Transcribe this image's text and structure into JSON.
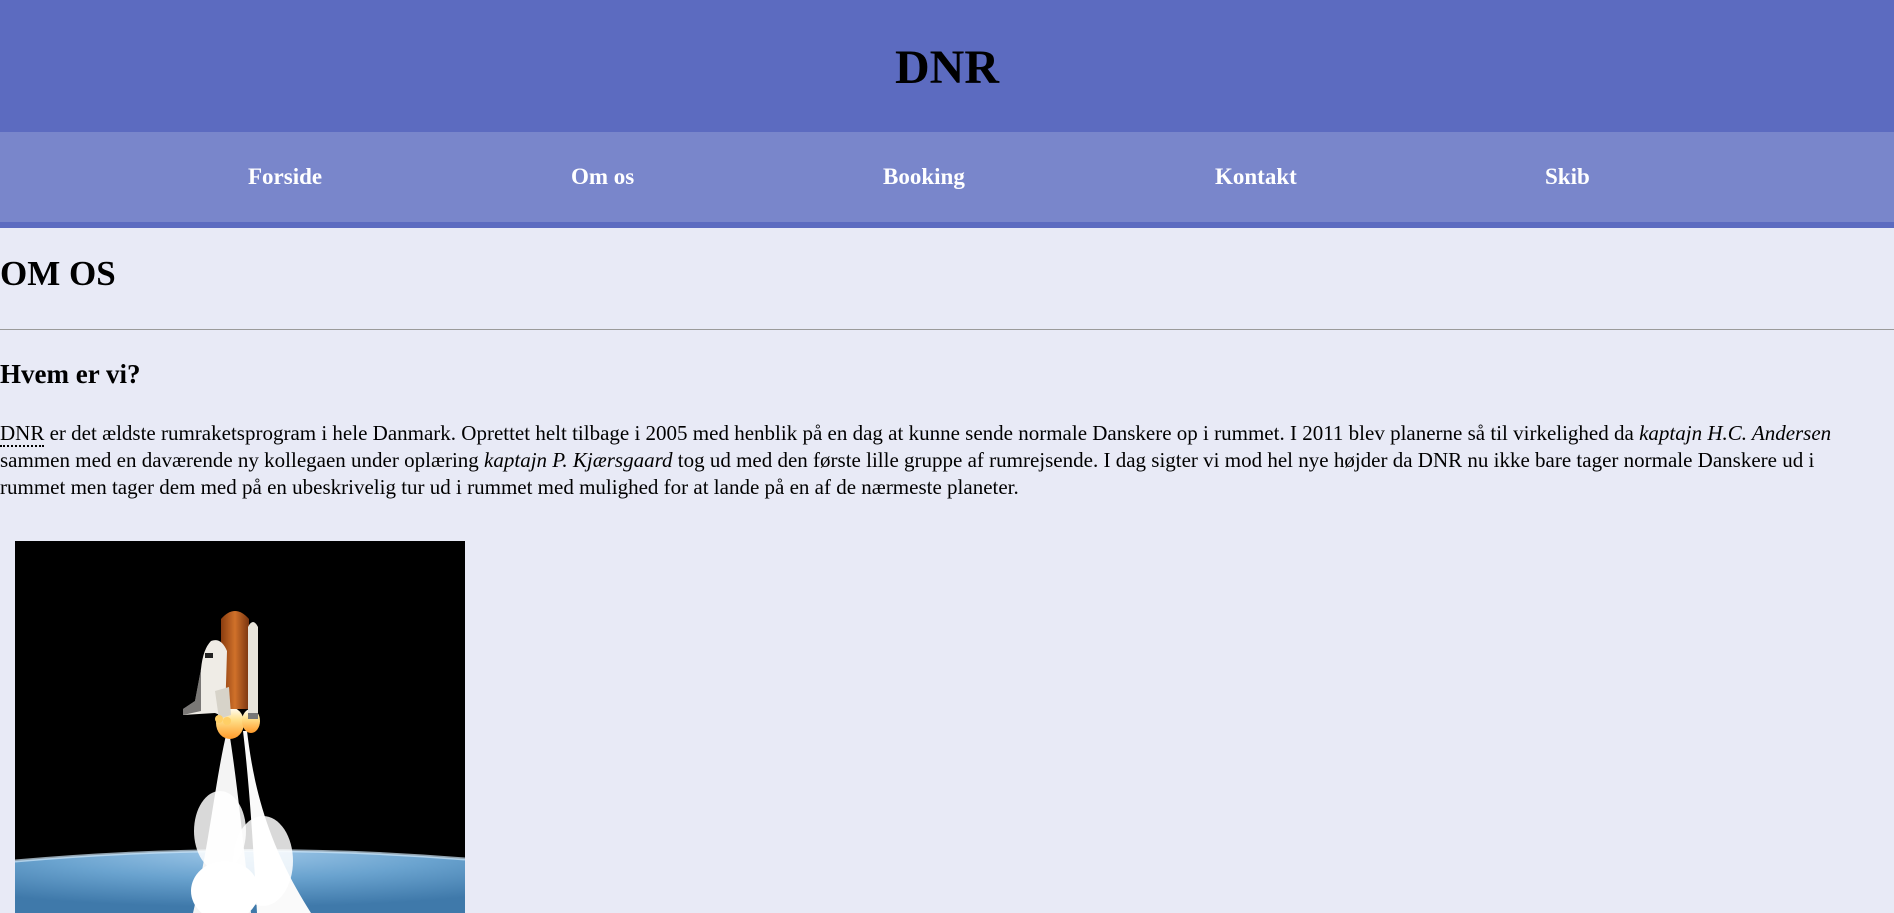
{
  "site": {
    "title": "DNR"
  },
  "nav": {
    "items": [
      {
        "label": "Forside"
      },
      {
        "label": "Om os"
      },
      {
        "label": "Booking"
      },
      {
        "label": "Kontakt"
      },
      {
        "label": "Skib"
      }
    ]
  },
  "main": {
    "page_title": "OM OS",
    "section_title": "Hvem er vi?",
    "intro": {
      "abbr": "DNR",
      "text_1": " er det ældste rumraketsprogram i hele Danmark. Oprettet helt tilbage i 2005 med henblik på en dag at kunne sende normale Danskere op i rummet. I 2011 blev planerne så til virkelighed da ",
      "captain_1": "kaptajn H.C. Andersen",
      "text_2": " sammen med en daværende ny kollegaen under oplæring ",
      "captain_2": "kaptajn P. Kjærsgaard",
      "text_3": " tog ud med den første lille gruppe af rumrejsende. I dag sigter vi mod hel nye højder da DNR nu ikke bare tager normale Danskere ud i rummet men tager dem med på en ubeskrivelig tur ud i rummet med mulighed for at lande på en af de nærmeste planeter."
    },
    "image": {
      "subject": "space-shuttle-launch-photo"
    }
  },
  "colors": {
    "header_bg": "#5c6bc0",
    "nav_bg": "#7986cb",
    "page_bg": "#e8eaf6",
    "nav_text": "#ffffff"
  }
}
